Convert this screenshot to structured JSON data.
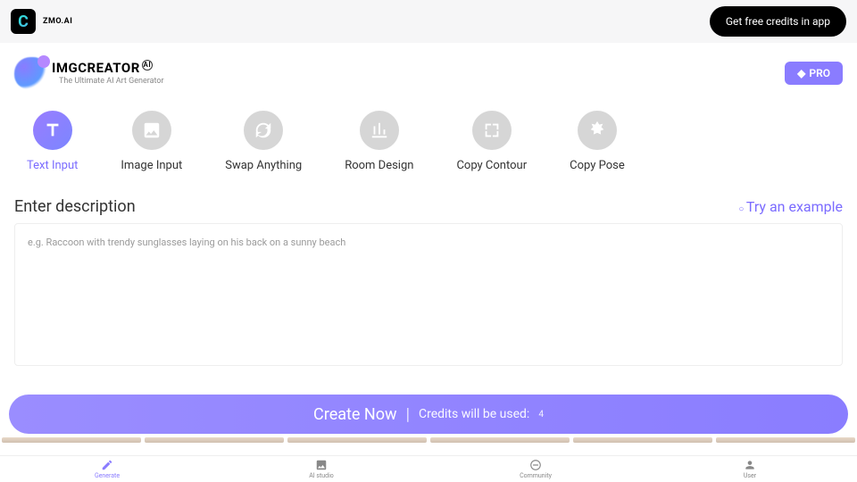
{
  "topbar": {
    "brand": "ZMO.AI",
    "cta": "Get free credits in app"
  },
  "brand": {
    "title": "IMGCREATOR",
    "badge": "AI",
    "subtitle": "The Ultimate AI Art Generator"
  },
  "pro_label": "PRO",
  "tabs": [
    {
      "label": "Text Input",
      "active": true
    },
    {
      "label": "Image Input",
      "active": false
    },
    {
      "label": "Swap Anything",
      "active": false
    },
    {
      "label": "Room Design",
      "active": false
    },
    {
      "label": "Copy Contour",
      "active": false
    },
    {
      "label": "Copy Pose",
      "active": false
    }
  ],
  "description": {
    "title": "Enter description",
    "try_example": "Try an example",
    "placeholder": "e.g. Raccoon with trendy sunglasses laying on his back on a sunny beach"
  },
  "create": {
    "label": "Create Now",
    "credits_label": "Credits will be used:",
    "credits_value": "4"
  },
  "bottomnav": [
    {
      "label": "Generate",
      "active": true
    },
    {
      "label": "AI studio",
      "active": false
    },
    {
      "label": "Community",
      "active": false
    },
    {
      "label": "User",
      "active": false
    }
  ]
}
